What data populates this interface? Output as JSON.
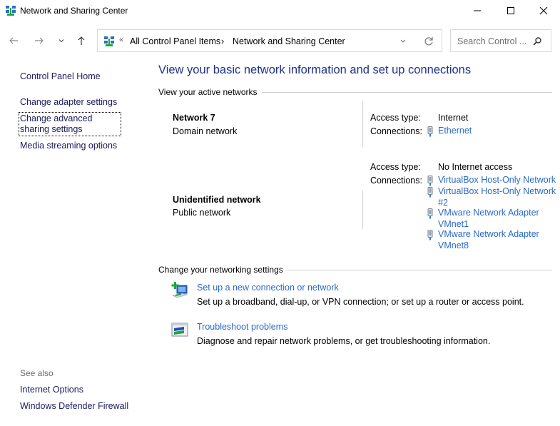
{
  "window": {
    "title": "Network and Sharing Center",
    "controls": {
      "minimize": "minimize",
      "maximize": "maximize",
      "close": "close"
    }
  },
  "navigation": {
    "back_icon": "arrow-left-icon",
    "forward_icon": "arrow-right-icon",
    "recent_icon": "chevron-down-icon",
    "up_icon": "arrow-up-icon",
    "address": {
      "overflow": "«",
      "breadcrumbs": [
        "All Control Panel Items",
        "Network and Sharing Center"
      ],
      "separator": "›"
    },
    "search": {
      "placeholder": "Search Control ..."
    }
  },
  "sidebar": {
    "items": [
      {
        "label": "Control Panel Home"
      },
      {
        "label": "Change adapter settings"
      },
      {
        "label": "Change advanced sharing settings"
      },
      {
        "label": "Media streaming options"
      }
    ],
    "see_also": {
      "heading": "See also",
      "items": [
        {
          "label": "Internet Options"
        },
        {
          "label": "Windows Defender Firewall"
        }
      ]
    }
  },
  "main": {
    "title": "View your basic network information and set up connections",
    "active_networks_heading": "View your active networks",
    "networks": [
      {
        "name": "Network 7",
        "type": "Domain network",
        "access_type_label": "Access type:",
        "access_type": "Internet",
        "connections_label": "Connections:",
        "connections": [
          "Ethernet"
        ]
      },
      {
        "name": "Unidentified network",
        "type": "Public network",
        "access_type_label": "Access type:",
        "access_type": "No Internet access",
        "connections_label": "Connections:",
        "connections": [
          "VirtualBox Host-Only Network",
          "VirtualBox Host-Only Network #2",
          "VMware Network Adapter VMnet1",
          "VMware Network Adapter VMnet8"
        ]
      }
    ],
    "settings_heading": "Change your networking settings",
    "tasks": [
      {
        "label": "Set up a new connection or network",
        "description": "Set up a broadband, dial-up, or VPN connection; or set up a router or access point.",
        "icon": "new-connection-icon"
      },
      {
        "label": "Troubleshoot problems",
        "description": "Diagnose and repair network problems, or get troubleshooting information.",
        "icon": "troubleshoot-icon"
      }
    ]
  },
  "colors": {
    "title_blue": "#1e3287",
    "link_blue": "#2a6ac8",
    "sidebar_link": "#1a1a5e"
  }
}
